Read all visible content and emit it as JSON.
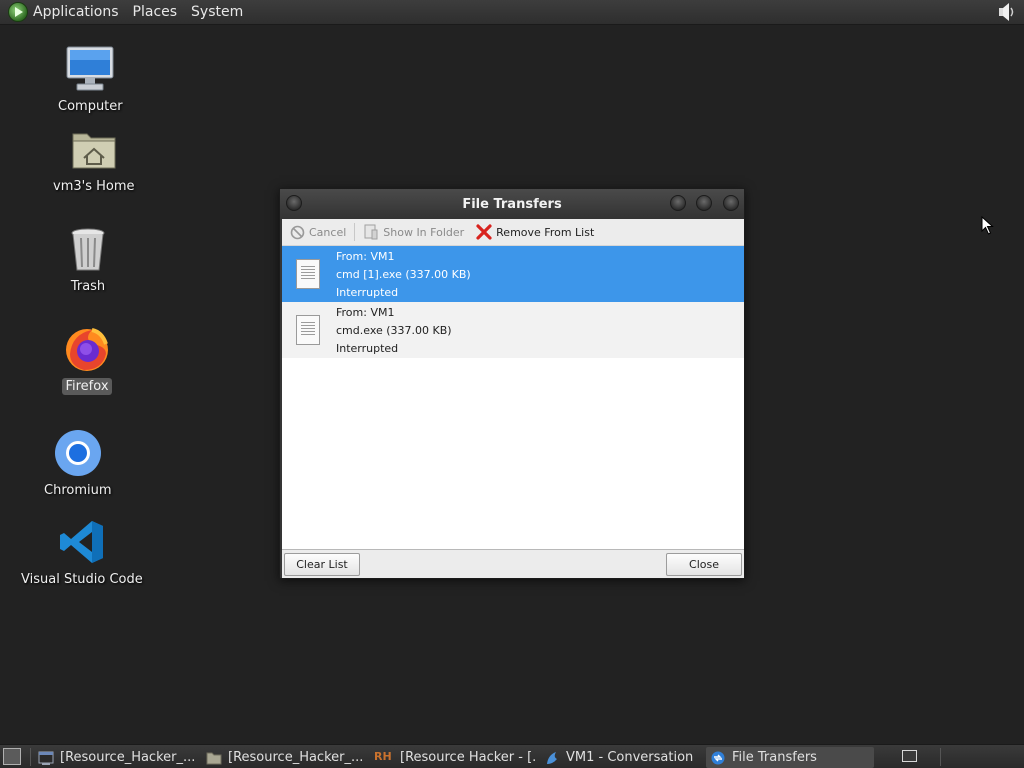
{
  "top_panel": {
    "menus": [
      "Applications",
      "Places",
      "System"
    ],
    "icons": {
      "menu_logo": "app-menu-logo-icon",
      "volume": "speaker-icon"
    }
  },
  "desktop": {
    "icons": [
      {
        "label": "Computer",
        "icon": "computer-icon"
      },
      {
        "label": "vm3's Home",
        "icon": "home-folder-icon"
      },
      {
        "label": "Trash",
        "icon": "trash-icon"
      },
      {
        "label": "Firefox",
        "icon": "firefox-icon"
      },
      {
        "label": "Chromium",
        "icon": "chromium-icon"
      },
      {
        "label": "Visual Studio Code",
        "icon": "vscode-icon"
      }
    ]
  },
  "dialog": {
    "title": "File Transfers",
    "toolbar": {
      "cancel": "Cancel",
      "show_in_folder": "Show In Folder",
      "remove_from_list": "Remove From List"
    },
    "transfers": [
      {
        "from": "From: VM1",
        "file": "cmd [1].exe (337.00 KB)",
        "status": "Interrupted",
        "selected": true
      },
      {
        "from": "From: VM1",
        "file": "cmd.exe (337.00 KB)",
        "status": "Interrupted",
        "selected": false
      }
    ],
    "buttons": {
      "clear_list": "Clear List",
      "close": "Close"
    }
  },
  "taskbar": {
    "tasks": [
      {
        "label": "[Resource_Hacker_...",
        "icon": "terminal-icon"
      },
      {
        "label": "[Resource_Hacker_...",
        "icon": "folder-icon"
      },
      {
        "label": "[Resource Hacker - [...",
        "icon": "resource-hacker-icon",
        "icon_text": "RH"
      },
      {
        "label": "VM1 - Conversation",
        "icon": "conversation-icon"
      },
      {
        "label": "File Transfers",
        "icon": "file-transfer-icon",
        "active": true
      }
    ]
  },
  "colors": {
    "desktop_bg": "#222222",
    "selection": "#3d96ea",
    "panel_bg": "#333333"
  }
}
